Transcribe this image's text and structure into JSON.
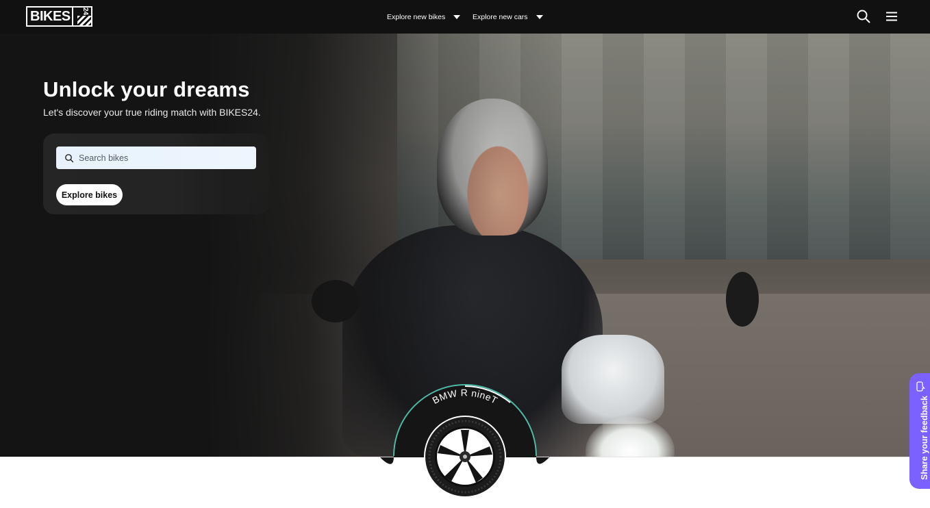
{
  "header": {
    "logo_text": "BIKES",
    "logo_number": "24",
    "nav": [
      {
        "label": "Explore new bikes"
      },
      {
        "label": "Explore new cars"
      }
    ]
  },
  "hero": {
    "title": "Unlock your dreams",
    "subtitle": "Let's discover your true riding match with BIKES24.",
    "search": {
      "placeholder": "Search bikes"
    },
    "cta_label": "Explore bikes"
  },
  "featured": {
    "model_name": "BMW R nineT"
  },
  "feedback": {
    "label": "Share your feedback"
  },
  "colors": {
    "header_bg": "#111111",
    "accent": "#7b61ff",
    "badge_ring": "#4fb9a6",
    "search_bg": "#e7f2fc"
  },
  "icons": [
    "search-icon",
    "menu-icon",
    "caret-down-icon",
    "chat-feedback-icon"
  ]
}
